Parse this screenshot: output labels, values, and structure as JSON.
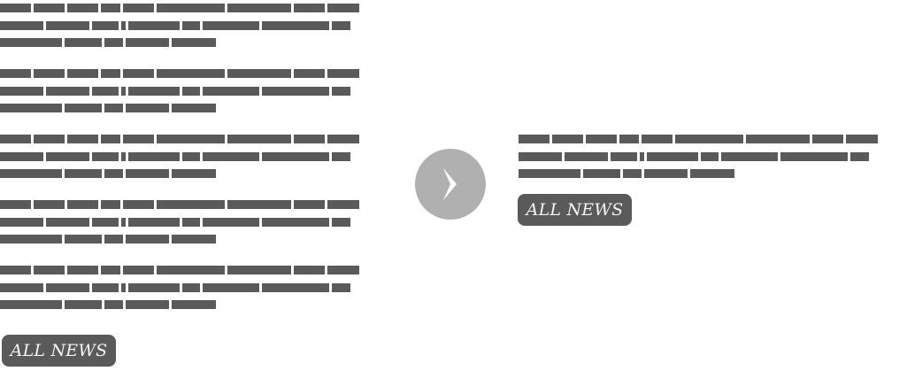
{
  "left_panel": {
    "items_count_label": "",
    "button_label": "ALL NEWS"
  },
  "right_panel": {
    "button_label": "ALL NEWS"
  },
  "arrow": {
    "icon": "chevron-right-icon",
    "circle_color": "#b0b0b0",
    "chevron_color": "#ffffff"
  },
  "colors": {
    "placeholder_text": "#5a5a5a",
    "button_bg": "#5a5a5a",
    "button_text": "#f4f4f4"
  }
}
